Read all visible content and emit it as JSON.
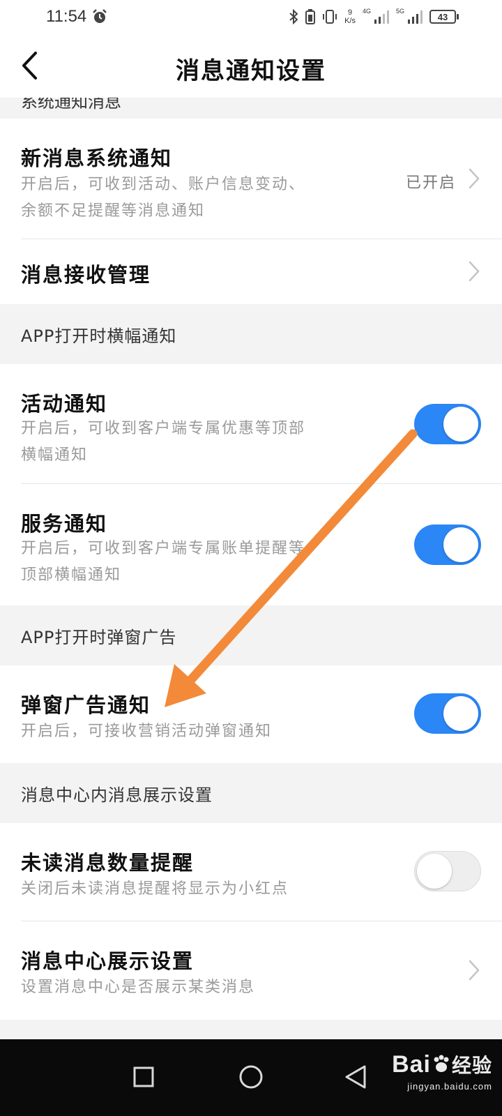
{
  "status_bar": {
    "time": "11:54",
    "speed_value": "9",
    "speed_unit": "K/s",
    "net1": "4G",
    "net2": "5G",
    "battery": "43"
  },
  "header": {
    "title": "消息通知设置"
  },
  "sections": {
    "system_clipped": "系统通知消息",
    "banner_label": "APP打开时横幅通知",
    "popup_label": "APP打开时弹窗广告",
    "center_label": "消息中心内消息展示设置"
  },
  "rows": {
    "new_message": {
      "title": "新消息系统通知",
      "desc": "开启后，可收到活动、账户信息变动、余额不足提醒等消息通知",
      "status": "已开启"
    },
    "receive_manage": {
      "title": "消息接收管理"
    },
    "activity": {
      "title": "活动通知",
      "desc": "开启后，可收到客户端专属优惠等顶部横幅通知",
      "enabled": true
    },
    "service": {
      "title": "服务通知",
      "desc": "开启后，可收到客户端专属账单提醒等顶部横幅通知",
      "enabled": true
    },
    "popup_ad": {
      "title": "弹窗广告通知",
      "desc": "开启后，可接收营销活动弹窗通知",
      "enabled": true
    },
    "unread_count": {
      "title": "未读消息数量提醒",
      "desc": "关闭后未读消息提醒将显示为小红点",
      "enabled": false
    },
    "center_display": {
      "title": "消息中心展示设置",
      "desc": "设置消息中心是否展示某类消息"
    }
  },
  "colors": {
    "toggle_on": "#2b86f6",
    "annotation_arrow": "#f28a3a"
  },
  "watermark": {
    "brand_latin": "Bai",
    "brand_cn": "经验",
    "url": "jingyan.baidu.com"
  },
  "icons": {
    "back": "chevron-left-icon",
    "chevron": "chevron-right-icon",
    "nav": [
      "square-icon",
      "circle-icon",
      "triangle-back-icon"
    ]
  }
}
